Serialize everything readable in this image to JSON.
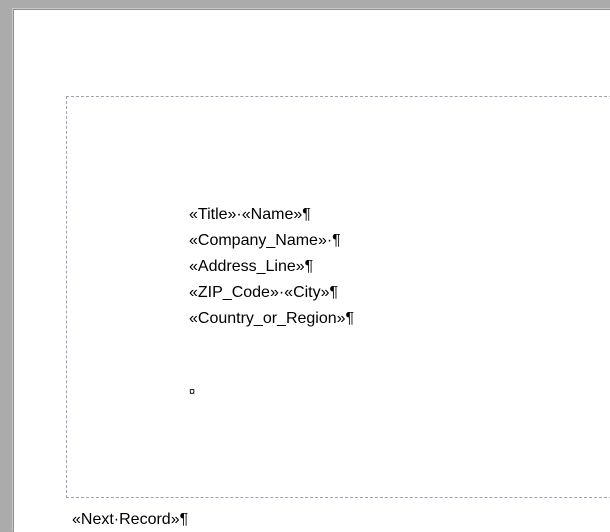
{
  "document": {
    "merge_fields": [
      "«Title»·«Name»¶",
      "«Company_Name»·¶",
      "«Address_Line»¶",
      "«ZIP_Code»·«City»¶",
      "«Country_or_Region»¶"
    ],
    "end_of_cell_mark": "¤",
    "next_record_field": "«Next·Record»¶"
  }
}
